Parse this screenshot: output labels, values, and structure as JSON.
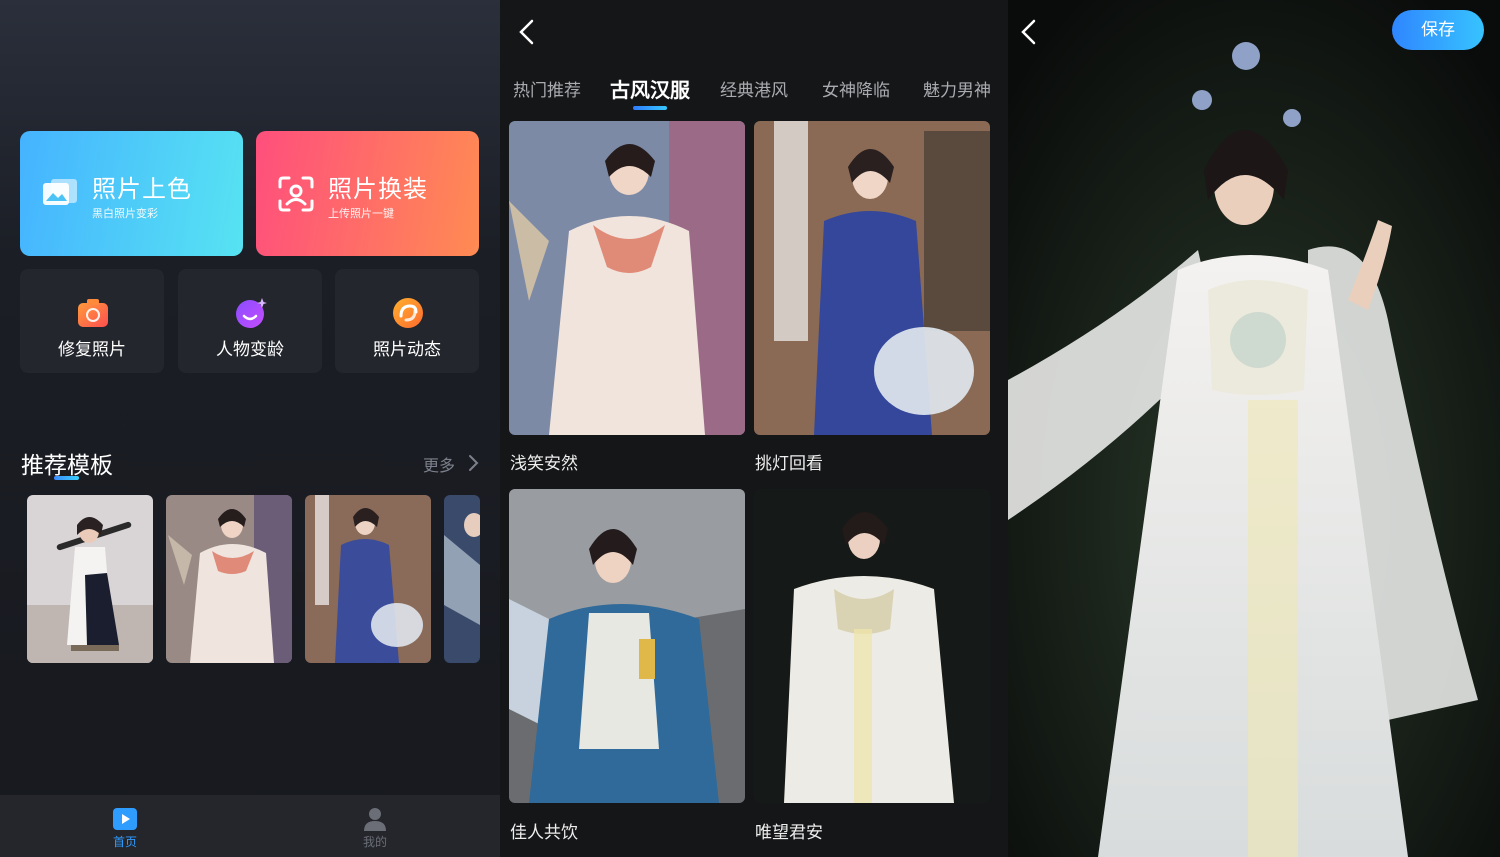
{
  "home": {
    "cards": [
      {
        "title": "照片上色",
        "subtitle": "黑白照片变彩"
      },
      {
        "title": "照片换装",
        "subtitle": "上传照片一键"
      }
    ],
    "tools": [
      {
        "label": "修复照片",
        "icon": "camera-icon"
      },
      {
        "label": "人物变龄",
        "icon": "age-sparkle-icon"
      },
      {
        "label": "照片动态",
        "icon": "swirl-icon"
      }
    ],
    "recommend": {
      "title": "推荐模板",
      "more": "更多"
    },
    "tabbar": {
      "home": "首页",
      "mine": "我的"
    }
  },
  "gallery": {
    "categories": [
      "热门推荐",
      "古风汉服",
      "经典港风",
      "女神降临",
      "魅力男神"
    ],
    "active_category": "古风汉服",
    "templates": [
      {
        "caption": "浅笑安然"
      },
      {
        "caption": "挑灯回看"
      },
      {
        "caption": "佳人共饮"
      },
      {
        "caption": "唯望君安"
      }
    ]
  },
  "result": {
    "save_label": "保存"
  },
  "colors": {
    "accent": "#2f9cff",
    "card_blue": "#45b3ff",
    "card_pink": "#ff4f7d",
    "background": "#17191e"
  }
}
